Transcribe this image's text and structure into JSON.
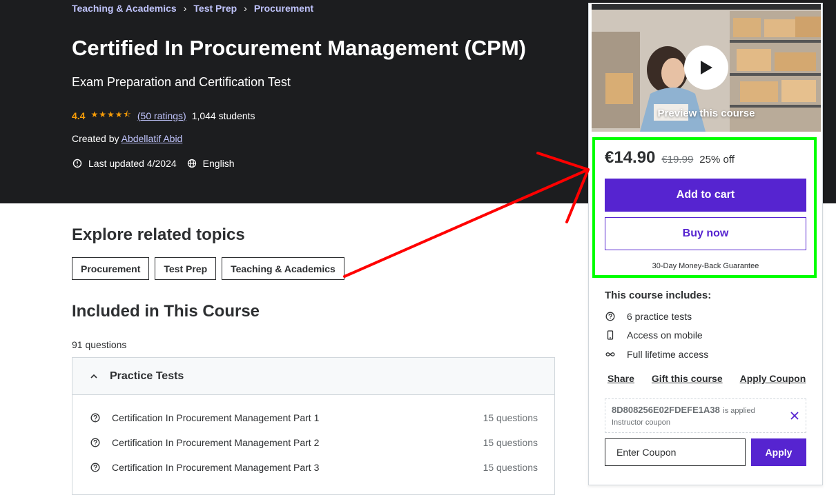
{
  "breadcrumb": [
    "Teaching & Academics",
    "Test Prep",
    "Procurement"
  ],
  "breadcrumb_sep": "›",
  "course": {
    "title": "Certified In Procurement Management (CPM)",
    "subtitle": "Exam Preparation and Certification Test",
    "rating": "4.4",
    "rating_value": 4.4,
    "stars": "★★★★⯪",
    "ratings_count": "(50 ratings)",
    "students": "1,044 students",
    "created_prefix": "Created by",
    "author": "Abdellatif Abid",
    "last_updated": "Last updated 4/2024",
    "language": "English"
  },
  "related": {
    "heading": "Explore related topics",
    "topics": [
      "Procurement",
      "Test Prep",
      "Teaching & Academics"
    ]
  },
  "included": {
    "heading": "Included in This Course",
    "question_count": "91 questions",
    "section_title": "Practice Tests",
    "tests": [
      {
        "name": "Certification In Procurement Management Part 1",
        "count": "15 questions"
      },
      {
        "name": "Certification In Procurement Management Part 2",
        "count": "15 questions"
      },
      {
        "name": "Certification In Procurement Management Part 3",
        "count": "15 questions"
      }
    ]
  },
  "card": {
    "preview_label": "Preview this course",
    "price": "€14.90",
    "original_price": "€19.99",
    "discount": "25% off",
    "add_to_cart": "Add to cart",
    "buy_now": "Buy now",
    "guarantee": "30-Day Money-Back Guarantee",
    "includes_heading": "This course includes:",
    "includes": [
      {
        "icon": "question-circle-icon",
        "label": "6 practice tests"
      },
      {
        "icon": "mobile-icon",
        "label": "Access on mobile"
      },
      {
        "icon": "infinity-icon",
        "label": "Full lifetime access"
      }
    ],
    "links": [
      "Share",
      "Gift this course",
      "Apply Coupon"
    ],
    "coupon_code": "8D808256E02FDEFE1A38",
    "coupon_applied_text": "is applied",
    "coupon_type": "Instructor coupon",
    "coupon_placeholder": "Enter Coupon",
    "apply": "Apply"
  },
  "colors": {
    "hero_bg": "#1c1d1f",
    "accent_purple": "#5624d0",
    "star_orange": "#f69c08",
    "highlight_green": "#00ff00",
    "annotation_red": "#ff0000"
  }
}
